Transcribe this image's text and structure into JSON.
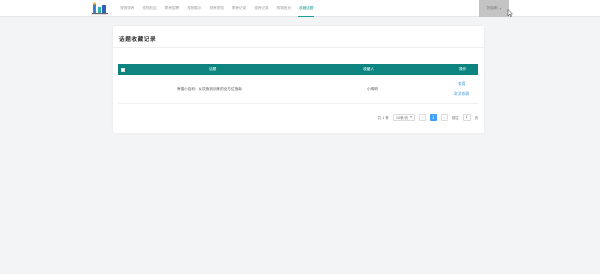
{
  "nav": {
    "items": [
      "宠物领养",
      "宠物社区",
      "寄养招聘",
      "宠物展示",
      "领养须知",
      "寄养记录",
      "领养记录",
      "购物首页",
      "收藏话题"
    ],
    "active_index": 8
  },
  "user": {
    "name": "张晓明",
    "caret": "▾"
  },
  "card": {
    "title": "话题收藏记录"
  },
  "table": {
    "headers": {
      "topic": "话题",
      "collector": "收藏人",
      "actions": "操作"
    },
    "rows": [
      {
        "topic": "养猫小百科：从饮食到训练的全方位指南",
        "collector": "小明明",
        "view": "查看",
        "cancel": "取消收藏"
      }
    ]
  },
  "pager": {
    "total": "共 1 条",
    "page_size": "10条/页",
    "prev": "‹",
    "current": "1",
    "next": "›",
    "goto_label": "前往",
    "goto_value": "1",
    "goto_suffix": "页"
  },
  "colors": {
    "accent": "#0d847f",
    "nav_active": "#1a9e98",
    "link": "#5aa6d6",
    "page_current": "#409eff"
  }
}
